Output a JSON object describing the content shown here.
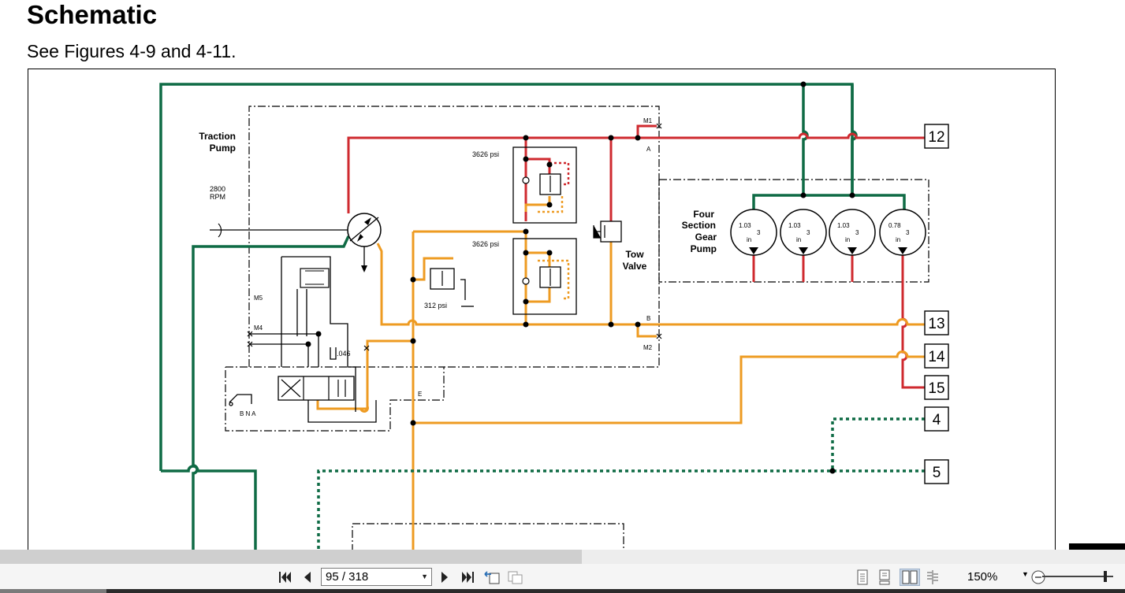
{
  "document": {
    "title": "Schematic",
    "subtitle": "See Figures 4-9 and 4-11."
  },
  "schematic": {
    "labels": {
      "traction_pump_line1": "Traction",
      "traction_pump_line2": "Pump",
      "rpm_value": "2800",
      "rpm_unit": "RPM",
      "relief_upper": "3626 psi",
      "relief_lower": "3626 psi",
      "charge_relief": "312 psi",
      "orifice": ".046",
      "port_m1": "M1",
      "port_m2": "M2",
      "port_m4": "M4",
      "port_m5": "M5",
      "port_a": "A",
      "port_b": "B",
      "port_e": "E",
      "bna": "B N A",
      "tow_valve_line1": "Tow",
      "tow_valve_line2": "Valve",
      "gear_pump_line1": "Four",
      "gear_pump_line2": "Section",
      "gear_pump_line3": "Gear",
      "gear_pump_line4": "Pump"
    },
    "gear_sections": [
      {
        "value": "1.03",
        "exp": "3",
        "unit": "in"
      },
      {
        "value": "1.03",
        "exp": "3",
        "unit": "in"
      },
      {
        "value": "1.03",
        "exp": "3",
        "unit": "in"
      },
      {
        "value": "0.78",
        "exp": "3",
        "unit": "in"
      }
    ],
    "connectors": [
      "12",
      "13",
      "14",
      "15",
      "4",
      "5"
    ],
    "colors": {
      "pressure": "#cf2a2f",
      "charge": "#ee9b22",
      "return": "#0f6b45"
    }
  },
  "viewer": {
    "page_indicator": "95 / 318",
    "zoom": "150%",
    "icons": {
      "first_page": "first-page-icon",
      "prev_page": "previous-page-icon",
      "next_page": "next-page-icon",
      "last_page": "last-page-icon",
      "prev_view": "previous-view-icon",
      "next_view": "next-view-icon",
      "single_page": "single-page-icon",
      "continuous": "continuous-page-icon",
      "facing": "facing-pages-icon",
      "continuous_facing": "continuous-facing-icon",
      "zoom_out": "zoom-out-icon"
    }
  }
}
